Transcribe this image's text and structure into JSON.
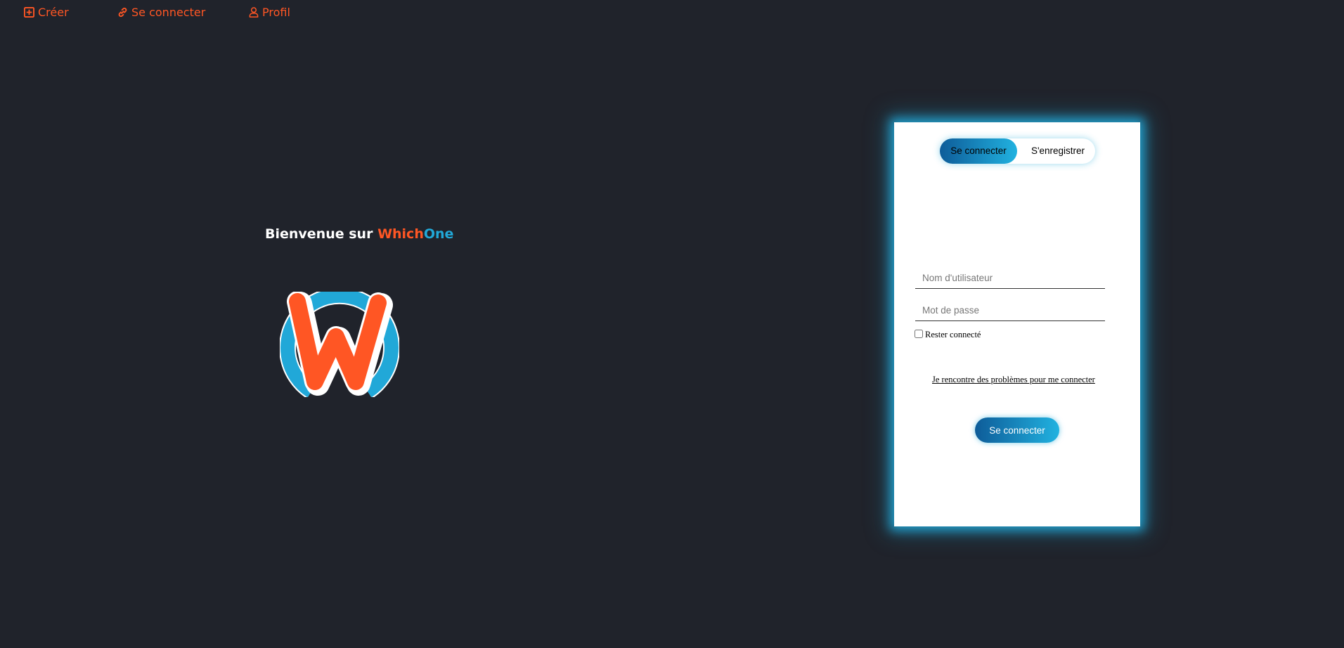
{
  "nav": {
    "items": [
      {
        "label": "Créer",
        "icon": "plus-square-icon"
      },
      {
        "label": "Se connecter",
        "icon": "link-icon"
      },
      {
        "label": "Profil",
        "icon": "user-icon"
      }
    ]
  },
  "welcome": {
    "prefix": "Bienvenue sur ",
    "brand_part1": "Which",
    "brand_part2": "One"
  },
  "login": {
    "tab_login": "Se connecter",
    "tab_register": "S'enregistrer",
    "username_placeholder": "Nom d'utilisateur",
    "password_placeholder": "Mot de passe",
    "remember_label": "Rester connecté",
    "help_link": "Je rencontre des problèmes pour me connecter",
    "submit_label": "Se connecter"
  },
  "colors": {
    "background": "#20232b",
    "accent_orange": "#ff5624",
    "accent_blue": "#21a8d8",
    "gradient_dark": "#0e5c99"
  }
}
